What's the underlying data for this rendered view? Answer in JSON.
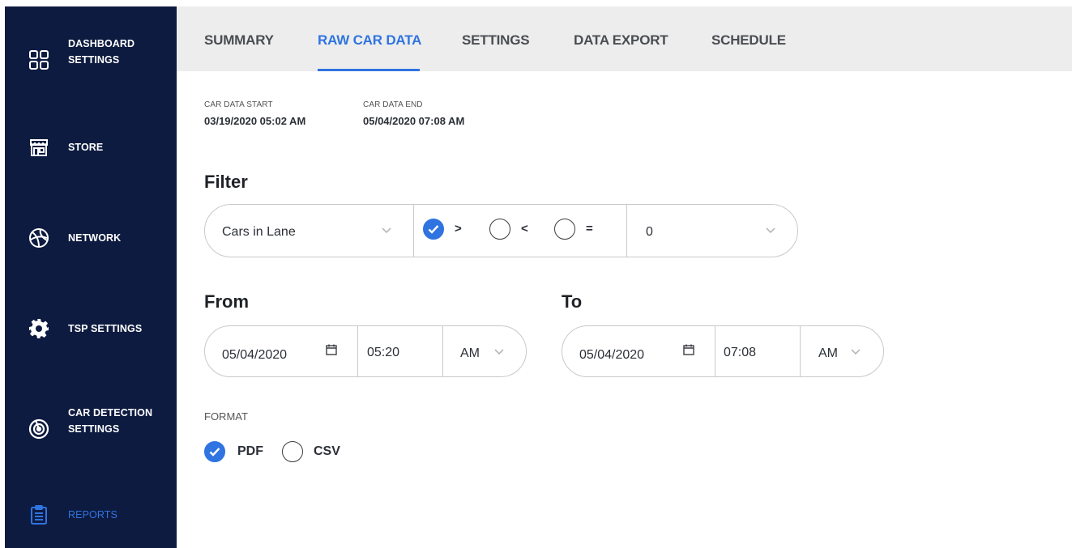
{
  "sidebar": {
    "items": [
      {
        "line1": "DASHBOARD",
        "line2": "SETTINGS",
        "icon": "dashboard-grid-icon"
      },
      {
        "line1": "STORE",
        "line2": "",
        "icon": "store-icon"
      },
      {
        "line1": "NETWORK",
        "line2": "",
        "icon": "network-globe-icon"
      },
      {
        "line1": "TSP SETTINGS",
        "line2": "",
        "icon": "gear-icon"
      },
      {
        "line1": "CAR DETECTION",
        "line2": "SETTINGS",
        "icon": "radar-icon"
      },
      {
        "line1": "REPORTS",
        "line2": "",
        "icon": "clipboard-icon"
      }
    ],
    "active_index": 5
  },
  "tabs": [
    {
      "label": "SUMMARY"
    },
    {
      "label": "RAW CAR DATA"
    },
    {
      "label": "SETTINGS"
    },
    {
      "label": "DATA EXPORT"
    },
    {
      "label": "SCHEDULE"
    }
  ],
  "active_tab": 1,
  "car_data": {
    "start_label": "CAR DATA START",
    "start_value": "03/19/2020 05:02 AM",
    "end_label": "CAR DATA END",
    "end_value": "05/04/2020 07:08 AM"
  },
  "filter": {
    "heading": "Filter",
    "field": "Cars in Lane",
    "operators": [
      {
        "symbol": ">",
        "checked": true
      },
      {
        "symbol": "<",
        "checked": false
      },
      {
        "symbol": "=",
        "checked": false
      }
    ],
    "value": "0"
  },
  "from": {
    "heading": "From",
    "date": "05/04/2020",
    "time": "05:20",
    "meridiem": "AM"
  },
  "to": {
    "heading": "To",
    "date": "05/04/2020",
    "time": "07:08",
    "meridiem": "AM"
  },
  "format": {
    "label": "FORMAT",
    "options": [
      {
        "label": "PDF",
        "checked": true
      },
      {
        "label": "CSV",
        "checked": false
      }
    ]
  },
  "colors": {
    "sidebar_bg": "#0e1b40",
    "accent": "#2f74e0",
    "tabbar_bg": "#ededed"
  }
}
